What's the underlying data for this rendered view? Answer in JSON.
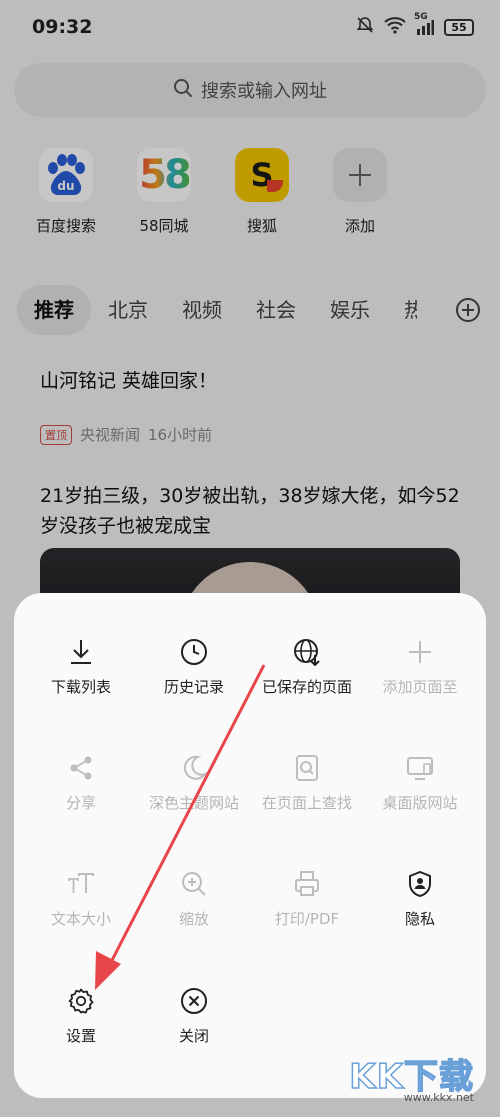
{
  "status_bar": {
    "time": "09:32",
    "network": "5G",
    "battery": "55"
  },
  "search": {
    "placeholder": "搜索或输入网址"
  },
  "shortcuts": [
    {
      "label": "百度搜索",
      "icon": "baidu-logo-icon"
    },
    {
      "label": "58同城",
      "icon": "58-logo-icon",
      "logo_text": "58"
    },
    {
      "label": "搜狐",
      "icon": "sohu-logo-icon",
      "logo_text": "S"
    },
    {
      "label": "添加",
      "icon": "plus-icon"
    }
  ],
  "tabs": [
    {
      "label": "推荐",
      "active": true
    },
    {
      "label": "北京"
    },
    {
      "label": "视频"
    },
    {
      "label": "社会"
    },
    {
      "label": "娱乐"
    },
    {
      "label": "热"
    }
  ],
  "feed": [
    {
      "title": "山河铭记 英雄回家！",
      "badge": "置顶",
      "source": "央视新闻",
      "time": "16小时前"
    },
    {
      "title": "21岁拍三级，30岁被出轨，38岁嫁大佬，如今52岁没孩子也被宠成宝"
    }
  ],
  "menu": {
    "items": [
      {
        "label": "下载列表",
        "icon": "download-icon",
        "enabled": true
      },
      {
        "label": "历史记录",
        "icon": "clock-icon",
        "enabled": true
      },
      {
        "label": "已保存的页面",
        "icon": "globe-download-icon",
        "enabled": true
      },
      {
        "label": "添加页面至",
        "icon": "plus-icon",
        "enabled": false
      },
      {
        "label": "分享",
        "icon": "share-icon",
        "enabled": false
      },
      {
        "label": "深色主题网站",
        "icon": "moon-icon",
        "enabled": false
      },
      {
        "label": "在页面上查找",
        "icon": "find-in-page-icon",
        "enabled": false
      },
      {
        "label": "桌面版网站",
        "icon": "desktop-icon",
        "enabled": false
      },
      {
        "label": "文本大小",
        "icon": "text-size-icon",
        "enabled": false
      },
      {
        "label": "缩放",
        "icon": "zoom-in-icon",
        "enabled": false
      },
      {
        "label": "打印/PDF",
        "icon": "printer-icon",
        "enabled": false
      },
      {
        "label": "隐私",
        "icon": "privacy-shield-icon",
        "enabled": true
      },
      {
        "label": "设置",
        "icon": "gear-icon",
        "enabled": true
      },
      {
        "label": "关闭",
        "icon": "close-circle-icon",
        "enabled": true
      }
    ]
  },
  "watermark": {
    "text": "KK下载",
    "url": "www.kkx.net"
  },
  "colors": {
    "accent_arrow": "#e8454a",
    "baidu_blue": "#2a5fd6",
    "sohu_yellow": "#f6c700",
    "badge_red": "#d0504b"
  }
}
